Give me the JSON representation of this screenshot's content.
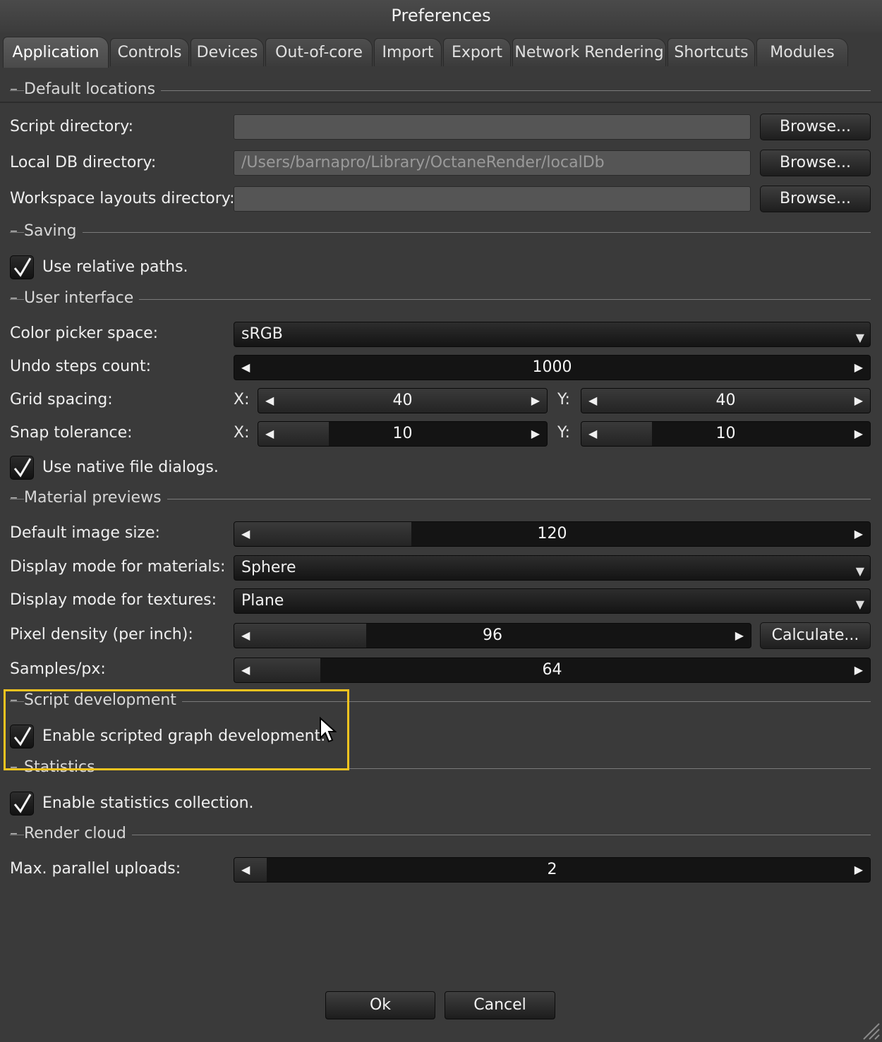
{
  "window": {
    "title": "Preferences"
  },
  "tabs": [
    {
      "label": "Application"
    },
    {
      "label": "Controls"
    },
    {
      "label": "Devices"
    },
    {
      "label": "Out-of-core"
    },
    {
      "label": "Import"
    },
    {
      "label": "Export"
    },
    {
      "label": "Network Rendering"
    },
    {
      "label": "Shortcuts"
    },
    {
      "label": "Modules"
    }
  ],
  "sections": {
    "default_locations": "Default locations",
    "saving": "Saving",
    "user_interface": "User interface",
    "material_previews": "Material previews",
    "script_development": "Script development",
    "statistics": "Statistics",
    "render_cloud": "Render cloud"
  },
  "section_dash": "–",
  "locations": {
    "script_dir": {
      "label": "Script directory:",
      "value": ""
    },
    "local_db_dir": {
      "label": "Local DB directory:",
      "value": "/Users/barnapro/Library/OctaneRender/localDb"
    },
    "workspace_dir": {
      "label": "Workspace layouts directory:",
      "value": ""
    },
    "browse_label": "Browse..."
  },
  "saving": {
    "relative_paths": {
      "label": "Use relative paths.",
      "checked": true
    }
  },
  "ui": {
    "color_picker": {
      "label": "Color picker space:",
      "value": "sRGB"
    },
    "undo_steps": {
      "label": "Undo steps count:",
      "value": "1000",
      "fill": 0.0
    },
    "grid_spacing": {
      "label": "Grid spacing:",
      "x": "40",
      "y": "40"
    },
    "snap_tolerance": {
      "label": "Snap tolerance:",
      "x": "10",
      "y": "10"
    },
    "axis_x": "X:",
    "axis_y": "Y:",
    "native_dialogs": {
      "label": "Use native file dialogs.",
      "checked": true
    }
  },
  "materials": {
    "image_size": {
      "label": "Default image size:",
      "value": "120"
    },
    "display_materials": {
      "label": "Display mode for materials:",
      "value": "Sphere"
    },
    "display_textures": {
      "label": "Display mode for textures:",
      "value": "Plane"
    },
    "pixel_density": {
      "label": "Pixel density (per inch):",
      "value": "96"
    },
    "calculate_label": "Calculate...",
    "samples": {
      "label": "Samples/px:",
      "value": "64"
    }
  },
  "script": {
    "enable_scripted": {
      "label": "Enable scripted graph development.",
      "checked": true
    }
  },
  "statistics": {
    "enable_stats": {
      "label": "Enable statistics collection.",
      "checked": true
    }
  },
  "render_cloud": {
    "max_uploads": {
      "label": "Max. parallel uploads:",
      "value": "2"
    }
  },
  "footer": {
    "ok": "Ok",
    "cancel": "Cancel"
  },
  "colors": {
    "highlight": "#f1c31f",
    "background": "#3a3a3a"
  }
}
